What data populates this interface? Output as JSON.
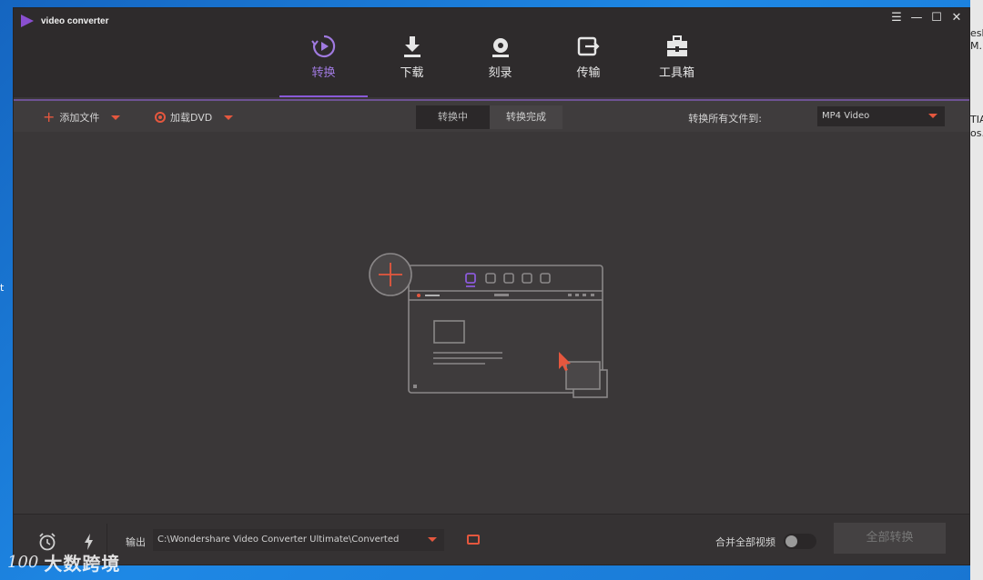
{
  "app": {
    "title": "video converter",
    "window_controls": {
      "menu": "☰",
      "minimize": "—",
      "maximize": "☐",
      "close": "✕"
    }
  },
  "nav": {
    "tabs": [
      {
        "label": "转换",
        "icon": "convert-icon",
        "active": true
      },
      {
        "label": "下载",
        "icon": "download-icon",
        "active": false
      },
      {
        "label": "刻录",
        "icon": "burn-icon",
        "active": false
      },
      {
        "label": "传输",
        "icon": "transfer-icon",
        "active": false
      },
      {
        "label": "工具箱",
        "icon": "toolbox-icon",
        "active": false
      }
    ]
  },
  "toolbar": {
    "add_files": "添加文件",
    "load_dvd": "加载DVD",
    "seg_converting": "转换中",
    "seg_finished": "转换完成",
    "convert_all_to": "转换所有文件到:",
    "format_value": "MP4 Video"
  },
  "bottom": {
    "output_label": "输出",
    "output_path": "C:\\Wondershare Video Converter Ultimate\\Converted",
    "merge_label": "合并全部视频",
    "merge_on": false,
    "convert_all": "全部转换"
  },
  "watermark": {
    "logo": "100",
    "text": "大数跨境"
  },
  "desktop": {
    "right_1": "esk",
    "right_2": "M...",
    "right_3": "TIA",
    "right_4": "os...",
    "left": "t"
  },
  "colors": {
    "accent": "#8a5ad8",
    "orange": "#e5573e",
    "window_bg": "#3a3738",
    "titlebar_bg": "#2e2b2c"
  }
}
